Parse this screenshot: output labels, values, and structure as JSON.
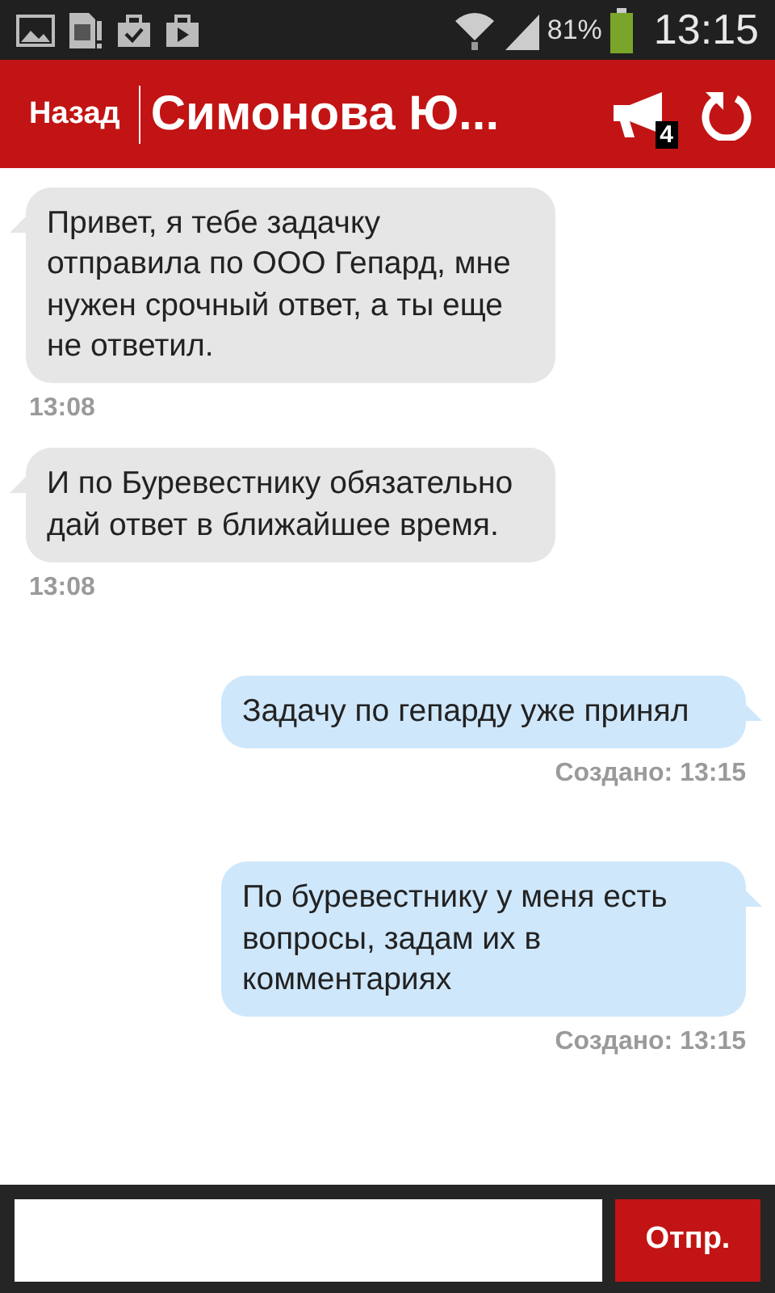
{
  "status_bar": {
    "battery": "81%",
    "time": "13:15"
  },
  "header": {
    "back": "Назад",
    "title": "Симонова Ю...",
    "badge": "4"
  },
  "messages": [
    {
      "kind": "incoming",
      "text": "Привет, я тебе задачку отправила по ООО Гепард, мне нужен срочный ответ, а ты еще не ответил.",
      "time": "13:08"
    },
    {
      "kind": "incoming",
      "text": "И по Буревестнику обязательно дай ответ в ближайшее время.",
      "time": "13:08"
    },
    {
      "kind": "outgoing",
      "text": "Задачу по гепарду уже принял",
      "time": "Создано: 13:15"
    },
    {
      "kind": "outgoing",
      "text": "По буревестнику у меня есть вопросы, задам их в комментариях",
      "time": "Создано: 13:15"
    }
  ],
  "composer": {
    "send": "Отпр."
  }
}
